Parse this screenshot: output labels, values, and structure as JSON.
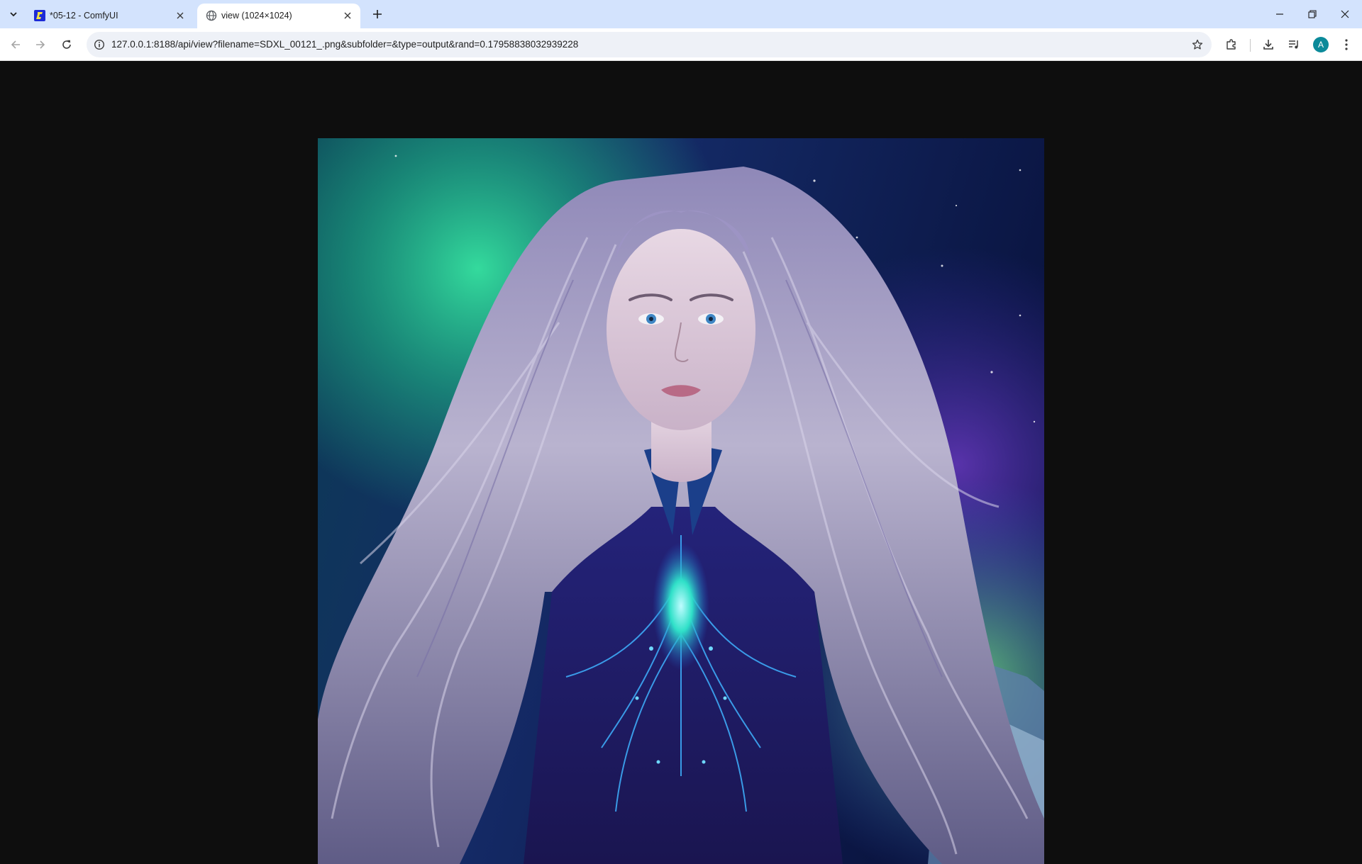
{
  "browser": {
    "tabs": [
      {
        "title": "*05-12 - ComfyUI",
        "favicon": "comfyui-logo-icon",
        "active": false
      },
      {
        "title": "view (1024×1024)",
        "favicon": "globe-icon",
        "active": true
      }
    ],
    "url": "127.0.0.1:8188/api/view?filename=SDXL_00121_.png&subfolder=&type=output&rand=0.17958838032939228",
    "profile_initial": "A",
    "accent_color": "#0b8a9a",
    "tabstrip_color": "#d3e3fd"
  },
  "image": {
    "subject": "portrait",
    "background_color": "#0e0e0e"
  }
}
